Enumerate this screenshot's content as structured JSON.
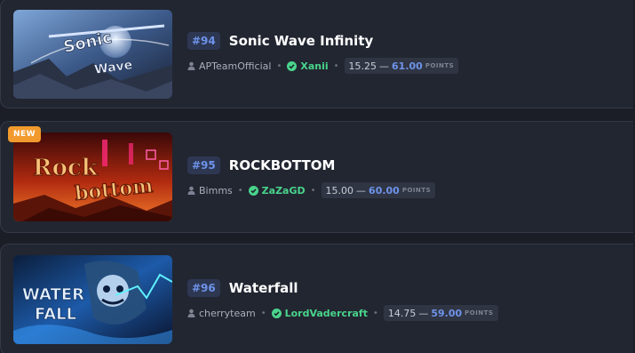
{
  "levels": [
    {
      "rank": "#94",
      "name": "Sonic Wave Infinity",
      "creator": "APTeamOfficial",
      "verifier": "Xanii",
      "points_low": "15.25",
      "points_high": "61.00",
      "points_label": "POINTS",
      "thumbnail_icon": "sonic-wave-thumbnail"
    },
    {
      "badge": "NEW",
      "rank": "#95",
      "name": "ROCKBOTTOM",
      "creator": "Bimms",
      "verifier": "ZaZaGD",
      "points_low": "15.00",
      "points_high": "60.00",
      "points_label": "POINTS",
      "thumbnail_icon": "rockbottom-thumbnail"
    },
    {
      "rank": "#96",
      "name": "Waterfall",
      "creator": "cherryteam",
      "verifier": "LordVadercraft",
      "points_low": "14.75",
      "points_high": "59.00",
      "points_label": "POINTS",
      "thumbnail_icon": "waterfall-thumbnail"
    }
  ],
  "separator": "—",
  "colors": {
    "background": "#1b1e27",
    "card": "#222631",
    "rank_text": "#6e93ea",
    "verifier": "#49d48c",
    "new_badge": "#f29a2e"
  }
}
